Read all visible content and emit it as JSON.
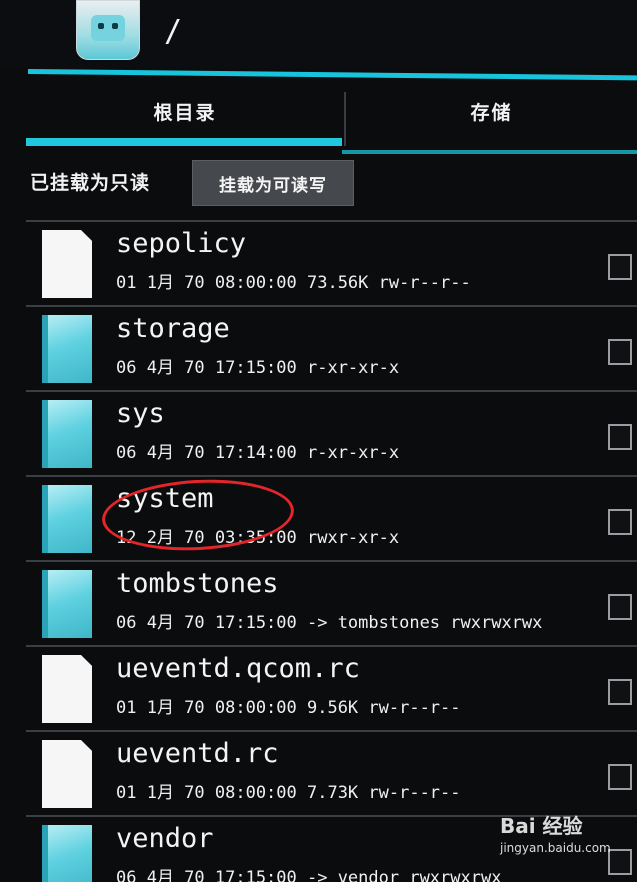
{
  "header": {
    "path": "/",
    "app_icon": "root-explorer-icon"
  },
  "tabs": [
    {
      "label": "根目录",
      "active": true
    },
    {
      "label": "存储",
      "active": false
    }
  ],
  "mount": {
    "status": "已挂载为只读",
    "button_label": "挂载为可读写"
  },
  "files": [
    {
      "name": "sepolicy",
      "meta": "01 1月 70 08:00:00 73.56K rw-r--r--",
      "type": "file"
    },
    {
      "name": "storage",
      "meta": "06 4月 70 17:15:00  r-xr-xr-x",
      "type": "folder"
    },
    {
      "name": "sys",
      "meta": "06 4月 70 17:14:00  r-xr-xr-x",
      "type": "folder"
    },
    {
      "name": "system",
      "meta": "12 2月 70 03:35:00  rwxr-xr-x",
      "type": "folder"
    },
    {
      "name": "tombstones",
      "meta": "06 4月 70 17:15:00 -> tombstones rwxrwxrwx",
      "type": "folder"
    },
    {
      "name": "ueventd.qcom.rc",
      "meta": "01 1月 70 08:00:00 9.56K rw-r--r--",
      "type": "file"
    },
    {
      "name": "ueventd.rc",
      "meta": "01 1月 70 08:00:00 7.73K rw-r--r--",
      "type": "file"
    },
    {
      "name": "vendor",
      "meta": "06 4月 70 17:15:00 -> vendor rwxrwxrwx",
      "type": "folder"
    }
  ],
  "watermark": {
    "brand": "Bai 经验",
    "url": "jingyan.baidu.com"
  },
  "colors": {
    "accent": "#21c7dd",
    "background": "#0b0c0e",
    "annotation": "#e4262b"
  }
}
